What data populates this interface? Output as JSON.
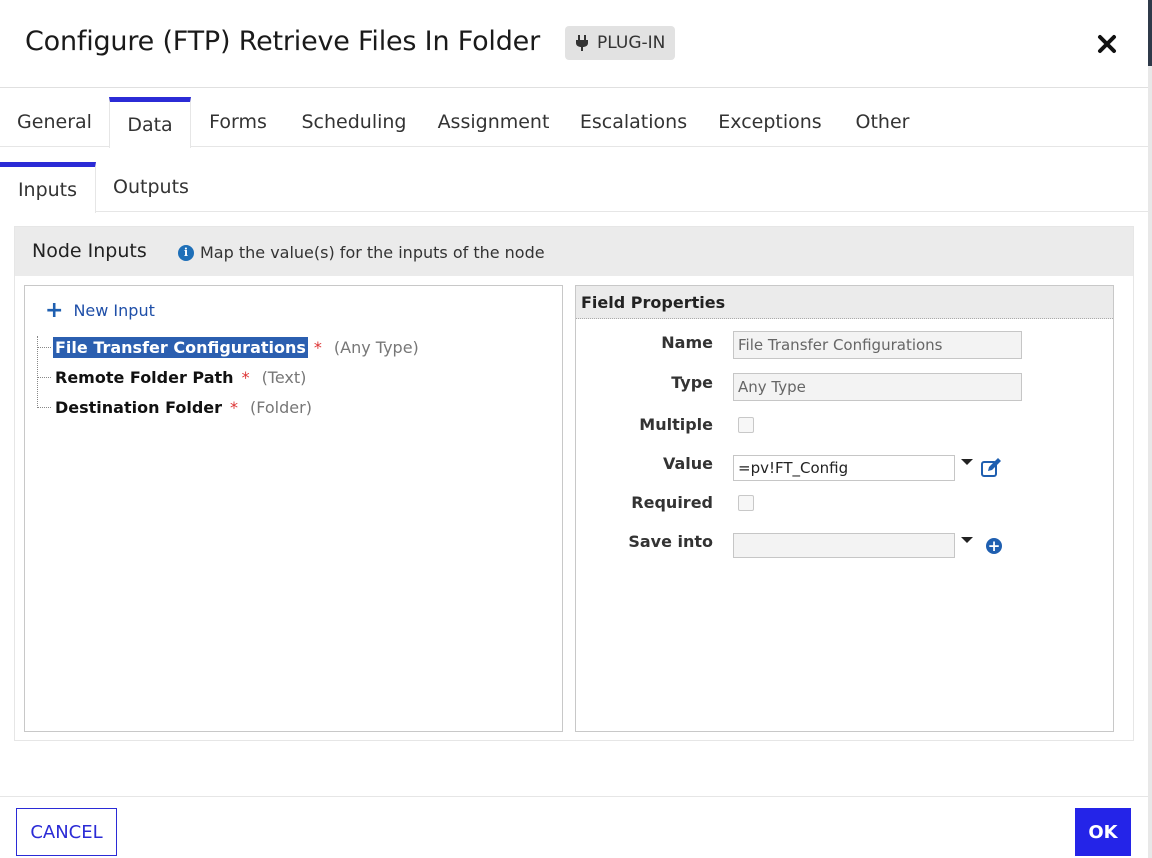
{
  "header": {
    "title": "Configure (FTP) Retrieve Files In Folder",
    "badge": "PLUG-IN"
  },
  "tabs": [
    {
      "label": "General",
      "active": false
    },
    {
      "label": "Data",
      "active": true
    },
    {
      "label": "Forms",
      "active": false
    },
    {
      "label": "Scheduling",
      "active": false
    },
    {
      "label": "Assignment",
      "active": false
    },
    {
      "label": "Escalations",
      "active": false
    },
    {
      "label": "Exceptions",
      "active": false
    },
    {
      "label": "Other",
      "active": false
    }
  ],
  "subtabs": [
    {
      "label": "Inputs",
      "active": true
    },
    {
      "label": "Outputs",
      "active": false
    }
  ],
  "panel": {
    "title": "Node Inputs",
    "info": "Map the value(s) for the inputs of the node"
  },
  "tree": {
    "new_input": "New Input",
    "items": [
      {
        "name": "File Transfer Configurations",
        "required": "*",
        "type": "(Any Type)",
        "selected": true
      },
      {
        "name": "Remote Folder Path",
        "required": "*",
        "type": "(Text)",
        "selected": false
      },
      {
        "name": "Destination Folder",
        "required": "*",
        "type": "(Folder)",
        "selected": false
      }
    ]
  },
  "field_properties": {
    "title": "Field Properties",
    "name_label": "Name",
    "name_value": "File Transfer Configurations",
    "type_label": "Type",
    "type_value": "Any Type",
    "multiple_label": "Multiple",
    "value_label": "Value",
    "value_value": "=pv!FT_Config",
    "required_label": "Required",
    "save_into_label": "Save into",
    "save_into_value": ""
  },
  "footer": {
    "cancel": "CANCEL",
    "ok": "OK"
  },
  "colors": {
    "accent": "#2b2bd6",
    "ok_button": "#2424e8",
    "selection": "#2b5fb0",
    "required": "#dd3333"
  }
}
